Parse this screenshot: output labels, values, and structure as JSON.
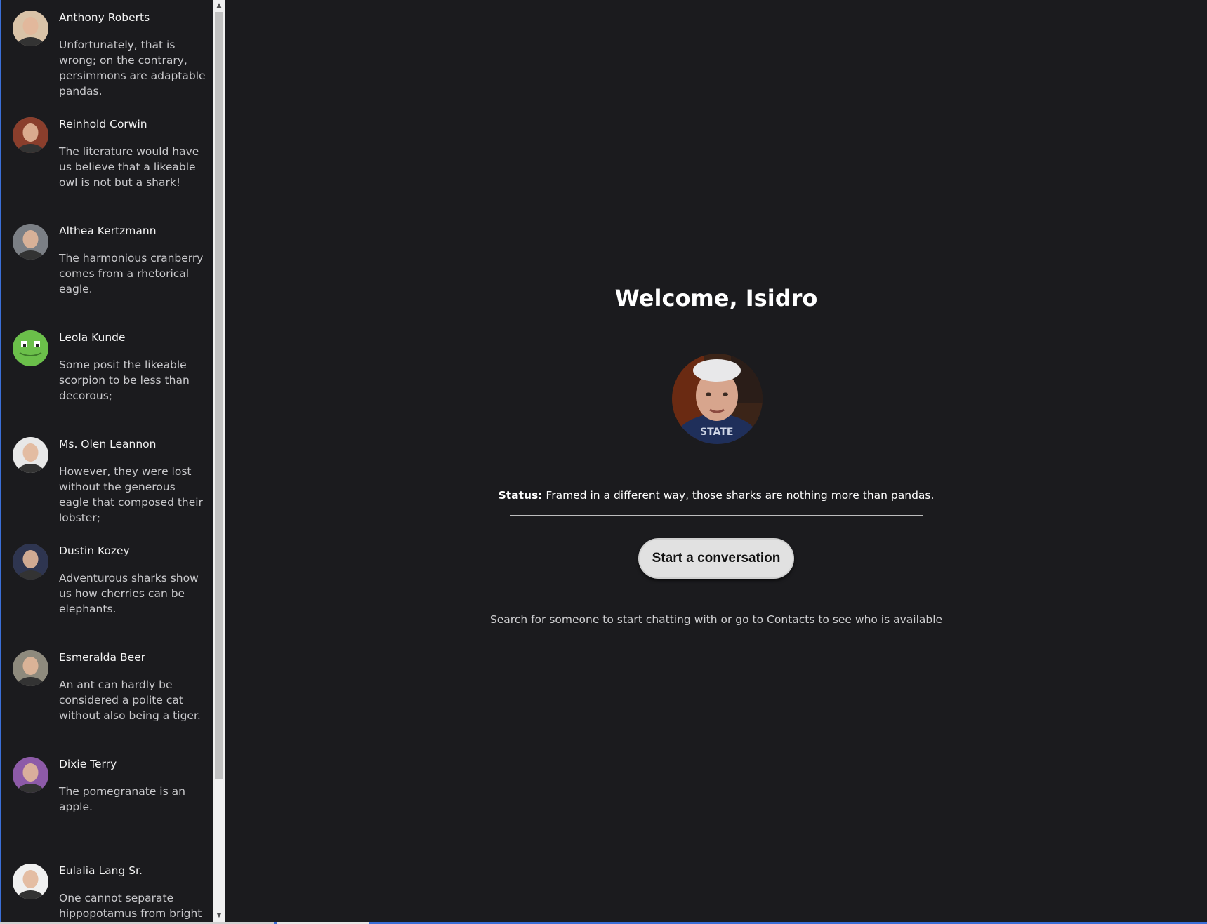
{
  "user": {
    "welcome": "Welcome, Isidro",
    "status_label": "Status:",
    "status_text": "Framed in a different way, those sharks are nothing more than pandas."
  },
  "actions": {
    "start_conversation": "Start a conversation",
    "hint": "Search for someone to start chatting with or go to Contacts to see who is available"
  },
  "conversations": [
    {
      "name": "Anthony Roberts",
      "message": "Unfortunately, that is wrong; on the contrary, persimmons are adaptable pandas.",
      "avatar": "avatar-face-1",
      "color": "#d9c3a8"
    },
    {
      "name": "Reinhold Corwin",
      "message": "The literature would have us believe that a likeable owl is not but a shark!",
      "avatar": "avatar-face-2",
      "color": "#8a3e2c"
    },
    {
      "name": "Althea Kertzmann",
      "message": "The harmonious cranberry comes from a rhetorical eagle.",
      "avatar": "avatar-face-3",
      "color": "#7b7f85"
    },
    {
      "name": "Leola Kunde",
      "message": "Some posit the likeable scorpion to be less than decorous;",
      "avatar": "avatar-green-creature",
      "color": "#6bbf4a"
    },
    {
      "name": "Ms. Olen Leannon",
      "message": "However, they were lost without the generous eagle that composed their lobster;",
      "avatar": "avatar-face-5",
      "color": "#e8e8e8"
    },
    {
      "name": "Dustin Kozey",
      "message": "Adventurous sharks show us how cherries can be elephants.",
      "avatar": "avatar-face-6",
      "color": "#2e3550"
    },
    {
      "name": "Esmeralda Beer",
      "message": "An ant can hardly be considered a polite cat without also being a tiger.",
      "avatar": "avatar-face-7",
      "color": "#8e8a7d"
    },
    {
      "name": "Dixie Terry",
      "message": "The pomegranate is an apple.",
      "avatar": "avatar-face-8",
      "color": "#8d5aa8"
    },
    {
      "name": "Eulalia Lang Sr.",
      "message": "One cannot separate hippopotamus from bright cherries!",
      "avatar": "avatar-face-9",
      "color": "#f0f0f0"
    }
  ]
}
